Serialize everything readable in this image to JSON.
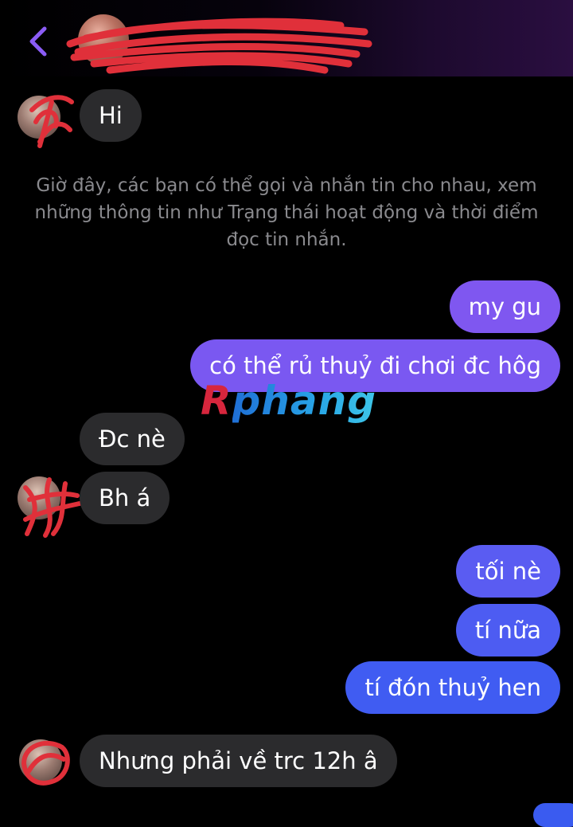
{
  "header": {
    "back_icon": "chevron-left-icon",
    "contact_name": "",
    "colors": {
      "accent": "#8b5cf6",
      "header_tint": "#2a0e40"
    }
  },
  "messages": [
    {
      "side": "in",
      "text": "Hi"
    },
    {
      "side": "out",
      "text": "my gu"
    },
    {
      "side": "out",
      "text": "có thể rủ thuỷ đi chơi đc hôg"
    },
    {
      "side": "in",
      "text": "Đc nè"
    },
    {
      "side": "in",
      "text": "Bh á"
    },
    {
      "side": "out",
      "text": "tối nè"
    },
    {
      "side": "out",
      "text": "tí nữa"
    },
    {
      "side": "out",
      "text": "tí đón thuỷ hen"
    },
    {
      "side": "in",
      "text": "Nhưng phải về trc 12h â"
    }
  ],
  "system_notice": "Giờ đây, các bạn có thể gọi và nhắn tin cho nhau, xem những thông tin như Trạng thái hoạt động và thời điểm đọc tin nhắn.",
  "watermark": {
    "first_letter": "R",
    "rest": "phang"
  },
  "bubble_colors": {
    "incoming": "#2b2b2d",
    "outgoing_top": "#8a5cf0",
    "outgoing_bottom": "#3d5cf2"
  }
}
